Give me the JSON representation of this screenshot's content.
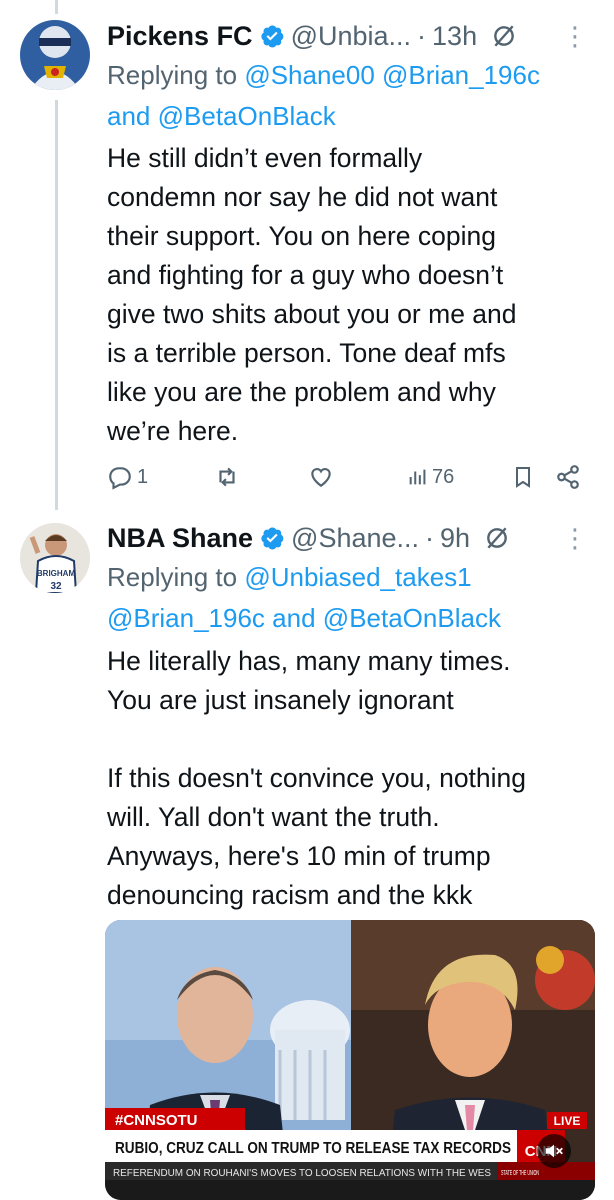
{
  "tweets": [
    {
      "name": "Pickens FC",
      "handle": "@Unbia...",
      "time": "13h",
      "reply_prefix": "Replying to",
      "reply_users_line1": "@Shane00 @Brian_196c",
      "reply_and": "and",
      "reply_users_line2": "@BetaOnBlack",
      "text": "He still didn’t even formally\ncondemn nor say he did not want\ntheir support. You on here coping\nand fighting for a guy who doesn’t\ngive two shits about you or me and\nis a terrible person. Tone deaf mfs\nlike you are the problem and why\nwe’re here.",
      "replies": "1",
      "views": "76"
    },
    {
      "name": "NBA Shane",
      "handle": "@Shane...",
      "time": "9h",
      "reply_prefix": "Replying to",
      "reply_users_line1": "@Unbiased_takes1",
      "reply_users_line2a": "@Brian_196c",
      "reply_and": "and",
      "reply_users_line2b": "@BetaOnBlack",
      "text": "He literally has, many many times.\nYou are just insanely ignorant\n\nIf this doesn't convince you, nothing\nwill. Yall don't want the truth.\nAnyways, here's 10 min of trump\ndenouncing racism and the kkk",
      "avatar_jersey": "BRIGHAM",
      "avatar_number": "32",
      "video": {
        "hashtag": "#CNNSOTU",
        "headline": "RUBIO, CRUZ CALL ON TRUMP TO RELEASE TAX RECORDS",
        "ticker": "REFERENDUM ON ROUHANI'S MOVES TO LOOSEN RELATIONS WITH THE WES",
        "ticker_right": "STATE OF THE UNION",
        "live": "LIVE",
        "network": "CNN"
      }
    }
  ],
  "colors": {
    "link": "#1d9bf0",
    "secondary": "#536471",
    "verified": "#1d9bf0",
    "cnn_red": "#cc0000"
  }
}
